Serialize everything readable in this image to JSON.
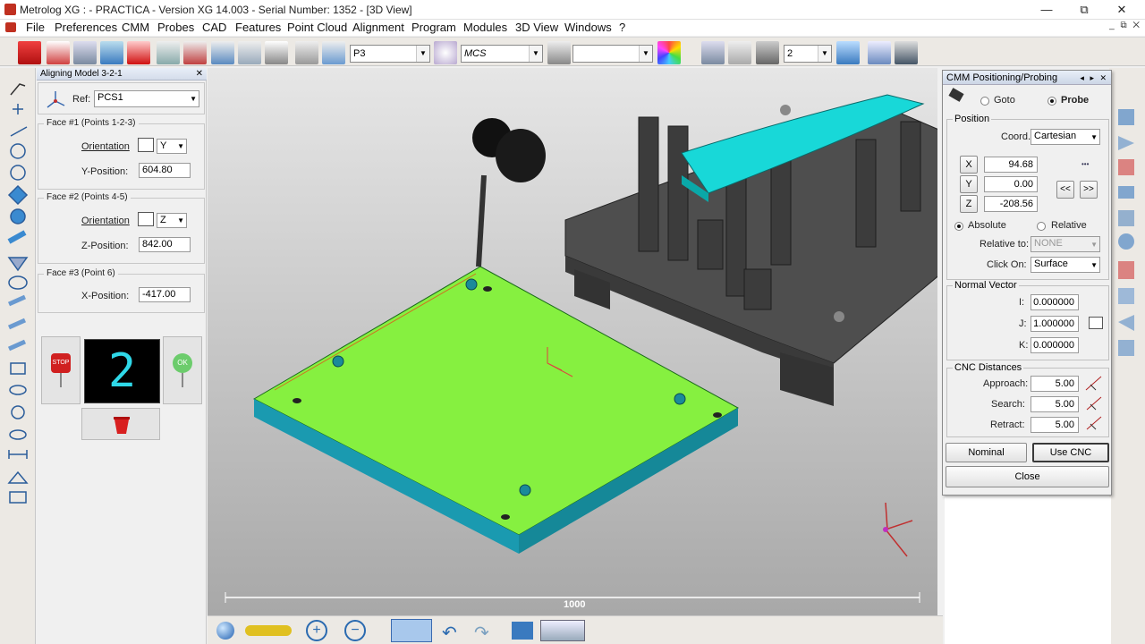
{
  "window": {
    "title": "Metrolog XG :  - PRACTICA - Version XG 14.003 - Serial Number: 1352 - [3D View]",
    "min": "—",
    "max": "⧉",
    "close": "✕"
  },
  "menu": [
    "File",
    "Preferences",
    "CMM",
    "Probes",
    "CAD",
    "Features",
    "Point Cloud",
    "Alignment",
    "Program",
    "Modules",
    "3D View",
    "Windows",
    "?"
  ],
  "toolbar": {
    "probe_combo": "P3",
    "frame_combo": "MCS",
    "empty_combo": "",
    "count_combo": "2"
  },
  "panel": {
    "title": "Aligning Model 3-2-1",
    "ref_label": "Ref:",
    "ref_value": "PCS1",
    "face1": {
      "legend": "Face #1 (Points 1-2-3)",
      "orient_label": "Orientation",
      "orient_value": "Y",
      "pos_label": "Y-Position:",
      "pos_value": "604.80"
    },
    "face2": {
      "legend": "Face #2 (Points 4-5)",
      "orient_label": "Orientation",
      "orient_value": "Z",
      "pos_label": "Z-Position:",
      "pos_value": "842.00"
    },
    "face3": {
      "legend": "Face #3 (Point 6)",
      "pos_label": "X-Position:",
      "pos_value": "-417.00"
    },
    "counter": "2",
    "stop_label": "STOP",
    "ok_label": "OK"
  },
  "view": {
    "scale_label": "1000"
  },
  "cmm": {
    "title": "CMM Positioning/Probing",
    "goto": "Goto",
    "probe": "Probe",
    "position_legend": "Position",
    "coord_label": "Coord.",
    "coord_value": "Cartesian",
    "x_label": "X",
    "y_label": "Y",
    "z_label": "Z",
    "x": "94.68",
    "y": "0.00",
    "z": "-208.56",
    "prev": "<<",
    "next": ">>",
    "dots": "•••",
    "absolute": "Absolute",
    "relative": "Relative",
    "relative_to_label": "Relative to:",
    "relative_to_value": "NONE",
    "click_on_label": "Click On:",
    "click_on_value": "Surface",
    "normal_legend": "Normal Vector",
    "i_label": "I:",
    "j_label": "J:",
    "k_label": "K:",
    "i": "0.000000",
    "j": "1.000000",
    "k": "0.000000",
    "cnc_legend": "CNC Distances",
    "approach_label": "Approach:",
    "search_label": "Search:",
    "retract_label": "Retract:",
    "approach": "5.00",
    "search": "5.00",
    "retract": "5.00",
    "nominal": "Nominal",
    "use_cnc": "Use CNC",
    "close": "Close"
  }
}
